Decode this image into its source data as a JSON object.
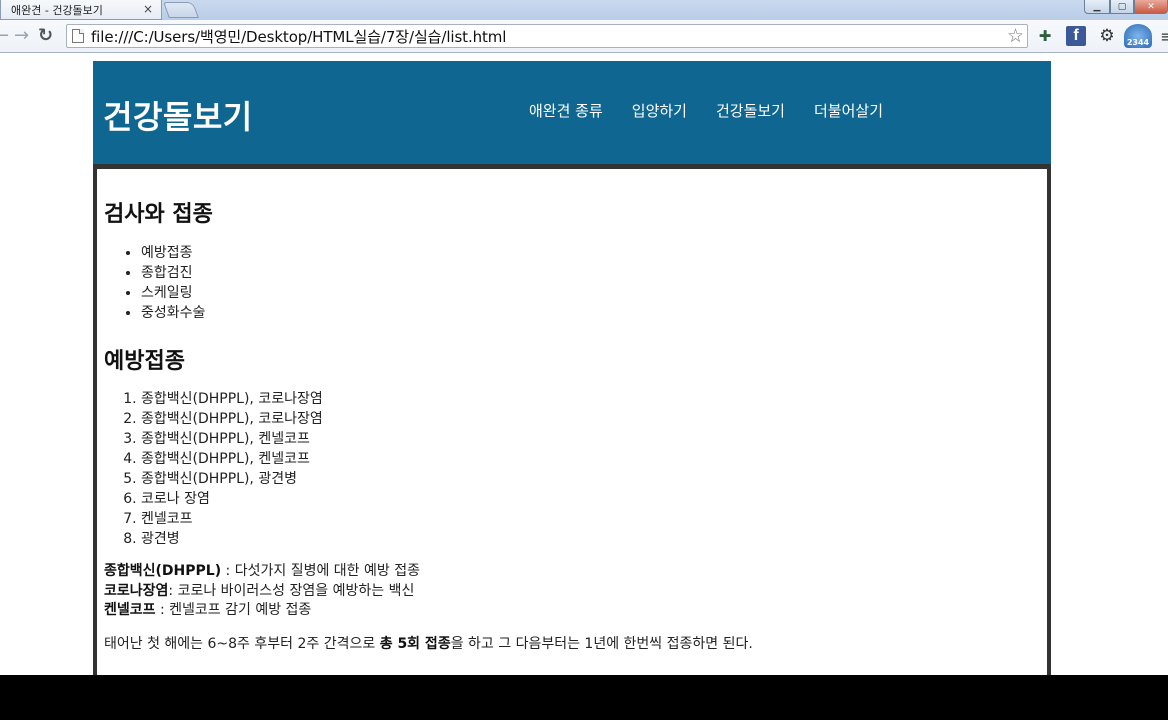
{
  "browser": {
    "tab_title": "애완견 - 건강돌보기",
    "tab_close": "×",
    "url": "file:///C:/Users/백영민/Desktop/HTML실습/7장/실습/list.html",
    "ext_2344_label": "2344"
  },
  "site": {
    "title": "건강돌보기",
    "nav": [
      "애완견 종류",
      "입양하기",
      "건강돌보기",
      "더불어살기"
    ]
  },
  "content": {
    "heading1": "검사와 접종",
    "checkups": [
      "예방접종",
      "종합검진",
      "스케일링",
      "중성화수술"
    ],
    "heading2": "예방접종",
    "vaccines": [
      "종합백신(DHPPL), 코로나장염",
      "종합백신(DHPPL), 코로나장염",
      "종합백신(DHPPL), 켄넬코프",
      "종합백신(DHPPL), 켄넬코프",
      "종합백신(DHPPL), 광견병",
      "코로나 장염",
      "켄넬코프",
      "광견병"
    ],
    "definitions": [
      {
        "term": "종합백신(DHPPL)",
        "desc": " : 다섯가지 질병에 대한 예방 접종"
      },
      {
        "term": "코로나장염",
        "desc": ": 코로나 바이러스성 장염을 예방하는 백신"
      },
      {
        "term": "켄넬코프",
        "desc": " : 켄넬코프 감기 예방 접종"
      }
    ],
    "note": {
      "before": "태어난 첫 해에는 6~8주 후부터 2주 간격으로 ",
      "bold": "총 5회 접종",
      "after": "을 하고 그 다음부터는 1년에 한번씩 접종하면 된다."
    }
  }
}
